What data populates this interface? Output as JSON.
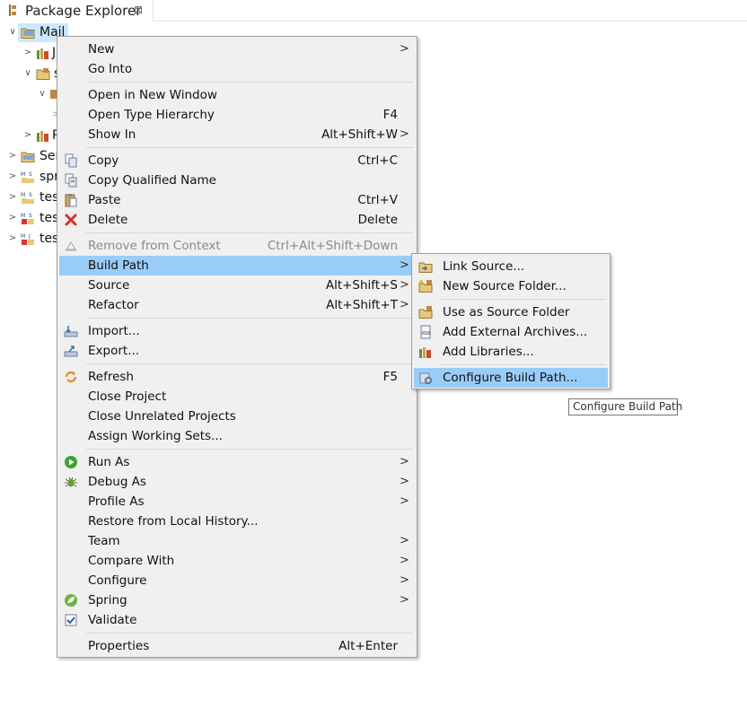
{
  "view": {
    "title": "Package Explorer",
    "close_glyph": "⊠"
  },
  "tree": {
    "rows": [
      {
        "label": "Mail",
        "expander": "v",
        "icon": "project-icon"
      },
      {
        "label": "J",
        "expander": ">",
        "icon": "library-icon"
      },
      {
        "label": "s",
        "expander": "v",
        "icon": "source-folder-icon"
      },
      {
        "label": "",
        "expander": "v",
        "icon": "package-icon"
      },
      {
        "label": "",
        "expander": ">",
        "icon": ""
      },
      {
        "label": "R",
        "expander": ">",
        "icon": "library-icon"
      },
      {
        "label": "Ser",
        "expander": ">",
        "icon": "folder-icon"
      },
      {
        "label": "spr",
        "expander": ">",
        "icon": "maven-project-icon"
      },
      {
        "label": "tes",
        "expander": ">",
        "icon": "maven-project-icon"
      },
      {
        "label": "tes",
        "expander": ">",
        "icon": "maven-project-error-icon"
      },
      {
        "label": "tes",
        "expander": ">",
        "icon": "maven-project-error-icon"
      }
    ]
  },
  "context_menu": {
    "items": [
      {
        "label": "New",
        "shortcut": "",
        "submenu": true
      },
      {
        "label": "Go Into",
        "shortcut": "",
        "submenu": false
      },
      {
        "label": "Open in New Window",
        "shortcut": "",
        "submenu": false
      },
      {
        "label": "Open Type Hierarchy",
        "shortcut": "F4",
        "submenu": false
      },
      {
        "label": "Show In",
        "shortcut": "Alt+Shift+W",
        "submenu": true
      },
      {
        "label": "Copy",
        "shortcut": "Ctrl+C",
        "submenu": false,
        "icon": "copy-icon"
      },
      {
        "label": "Copy Qualified Name",
        "shortcut": "",
        "submenu": false,
        "icon": "copy-qualified-icon"
      },
      {
        "label": "Paste",
        "shortcut": "Ctrl+V",
        "submenu": false,
        "icon": "paste-icon"
      },
      {
        "label": "Delete",
        "shortcut": "Delete",
        "submenu": false,
        "icon": "delete-icon"
      },
      {
        "label": "Remove from Context",
        "shortcut": "Ctrl+Alt+Shift+Down",
        "submenu": false,
        "disabled": true,
        "icon": "remove-context-icon"
      },
      {
        "label": "Build Path",
        "shortcut": "",
        "submenu": true,
        "highlighted": true
      },
      {
        "label": "Source",
        "shortcut": "Alt+Shift+S",
        "submenu": true
      },
      {
        "label": "Refactor",
        "shortcut": "Alt+Shift+T",
        "submenu": true
      },
      {
        "label": "Import...",
        "shortcut": "",
        "submenu": false,
        "icon": "import-icon"
      },
      {
        "label": "Export...",
        "shortcut": "",
        "submenu": false,
        "icon": "export-icon"
      },
      {
        "label": "Refresh",
        "shortcut": "F5",
        "submenu": false,
        "icon": "refresh-icon"
      },
      {
        "label": "Close Project",
        "shortcut": "",
        "submenu": false
      },
      {
        "label": "Close Unrelated Projects",
        "shortcut": "",
        "submenu": false
      },
      {
        "label": "Assign Working Sets...",
        "shortcut": "",
        "submenu": false
      },
      {
        "label": "Run As",
        "shortcut": "",
        "submenu": true,
        "icon": "run-icon"
      },
      {
        "label": "Debug As",
        "shortcut": "",
        "submenu": true,
        "icon": "debug-icon"
      },
      {
        "label": "Profile As",
        "shortcut": "",
        "submenu": true
      },
      {
        "label": "Restore from Local History...",
        "shortcut": "",
        "submenu": false
      },
      {
        "label": "Team",
        "shortcut": "",
        "submenu": true
      },
      {
        "label": "Compare With",
        "shortcut": "",
        "submenu": true
      },
      {
        "label": "Configure",
        "shortcut": "",
        "submenu": true
      },
      {
        "label": "Spring",
        "shortcut": "",
        "submenu": true,
        "icon": "spring-icon"
      },
      {
        "label": "Validate",
        "shortcut": "",
        "submenu": false,
        "icon": "validate-icon"
      },
      {
        "label": "Properties",
        "shortcut": "Alt+Enter",
        "submenu": false
      }
    ]
  },
  "build_path_menu": {
    "items": [
      {
        "label": "Link Source...",
        "icon": "link-source-icon"
      },
      {
        "label": "New Source Folder...",
        "icon": "new-source-folder-icon"
      },
      {
        "label": "Use as Source Folder",
        "icon": "use-source-folder-icon"
      },
      {
        "label": "Add External Archives...",
        "icon": "external-archive-icon"
      },
      {
        "label": "Add Libraries...",
        "icon": "add-library-icon"
      },
      {
        "label": "Configure Build Path...",
        "icon": "configure-build-path-icon",
        "highlighted": true
      }
    ]
  },
  "tooltip": {
    "text": "Configure Build Path"
  },
  "colors": {
    "selection": "#99cdf8",
    "tree_selection": "#cde8ff",
    "menu_bg": "#f0f0f0"
  }
}
